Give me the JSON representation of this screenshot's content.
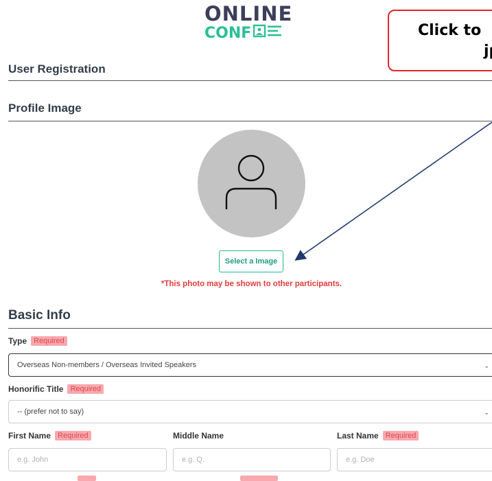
{
  "logo": {
    "line1": "ONLINE",
    "line2": "CONF"
  },
  "callout": {
    "line1": "Click to",
    "line2": "jpg"
  },
  "page_title": "User Registration",
  "profile": {
    "title": "Profile Image",
    "avatar_icon": "user-icon",
    "select_button": "Select a Image",
    "note": "*This photo may be shown to other participants."
  },
  "basic_info": {
    "title": "Basic Info",
    "required_badge": "Required",
    "type_label": "Type",
    "type_value": "Overseas Non-members / Overseas Invited Speakers",
    "honorific_label": "Honorific Title",
    "honorific_value": "-- (prefer not to say)",
    "first_name_label": "First Name",
    "first_name_placeholder": "e.g. John",
    "middle_name_label": "Middle Name",
    "middle_name_placeholder": "e.g. Q.",
    "last_name_label": "Last Name",
    "last_name_placeholder": "e.g. Doe"
  },
  "colors": {
    "accent": "#2bbf93",
    "required_bg": "#f7a9ad",
    "required_text": "#e04850",
    "warning_text": "#e33b3b",
    "callout_border": "#e32424",
    "arrow": "#1f3a6e"
  }
}
